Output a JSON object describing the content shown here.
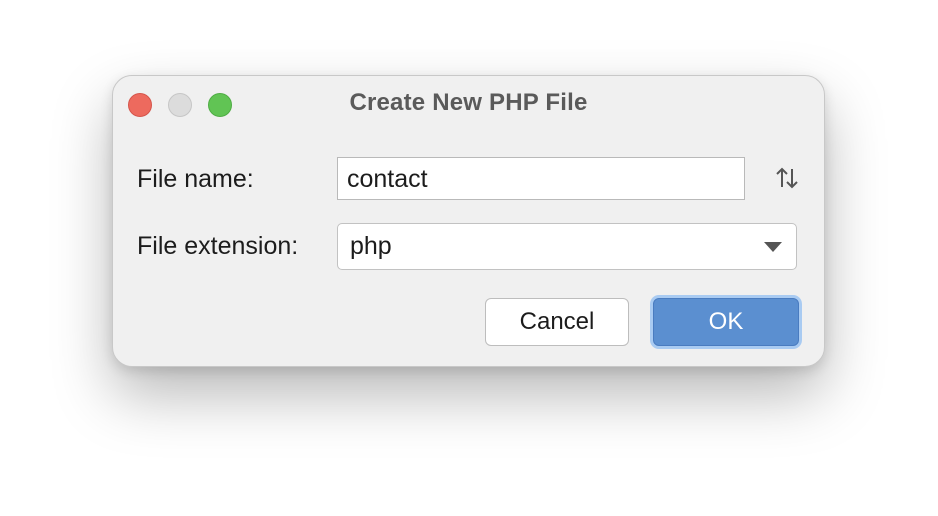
{
  "dialog": {
    "title": "Create New PHP File"
  },
  "form": {
    "file_name_label": "File name:",
    "file_name_value": "contact",
    "file_extension_label": "File extension:",
    "file_extension_value": "php"
  },
  "buttons": {
    "cancel_label": "Cancel",
    "ok_label": "OK"
  },
  "icons": {
    "sort": "sort-order-icon",
    "dropdown": "chevron-down-icon"
  },
  "colors": {
    "close": "#ed6a5e",
    "minimize": "#dcdcdc",
    "maximize": "#61c454",
    "primary_button": "#5b8fd0"
  }
}
